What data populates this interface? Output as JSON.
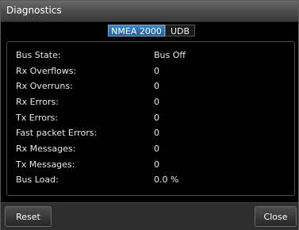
{
  "window": {
    "title": "Diagnostics"
  },
  "tabs": [
    {
      "label": "NMEA 2000",
      "active": true
    },
    {
      "label": "UDB",
      "active": false
    }
  ],
  "rows": [
    {
      "label": "Bus State:",
      "value": "Bus Off"
    },
    {
      "label": "Rx Overflows:",
      "value": "0"
    },
    {
      "label": "Rx Overruns:",
      "value": "0"
    },
    {
      "label": "Rx Errors:",
      "value": "0"
    },
    {
      "label": "Tx Errors:",
      "value": "0"
    },
    {
      "label": "Fast packet Errors:",
      "value": "0"
    },
    {
      "label": "Rx Messages:",
      "value": "0"
    },
    {
      "label": "Tx Messages:",
      "value": "0"
    },
    {
      "label": "Bus Load:",
      "value": "0.0 %"
    }
  ],
  "footer": {
    "reset_label": "Reset",
    "close_label": "Close"
  },
  "colors": {
    "accent": "#2a72b8",
    "background": "#000000",
    "titlebar": "#555555"
  }
}
